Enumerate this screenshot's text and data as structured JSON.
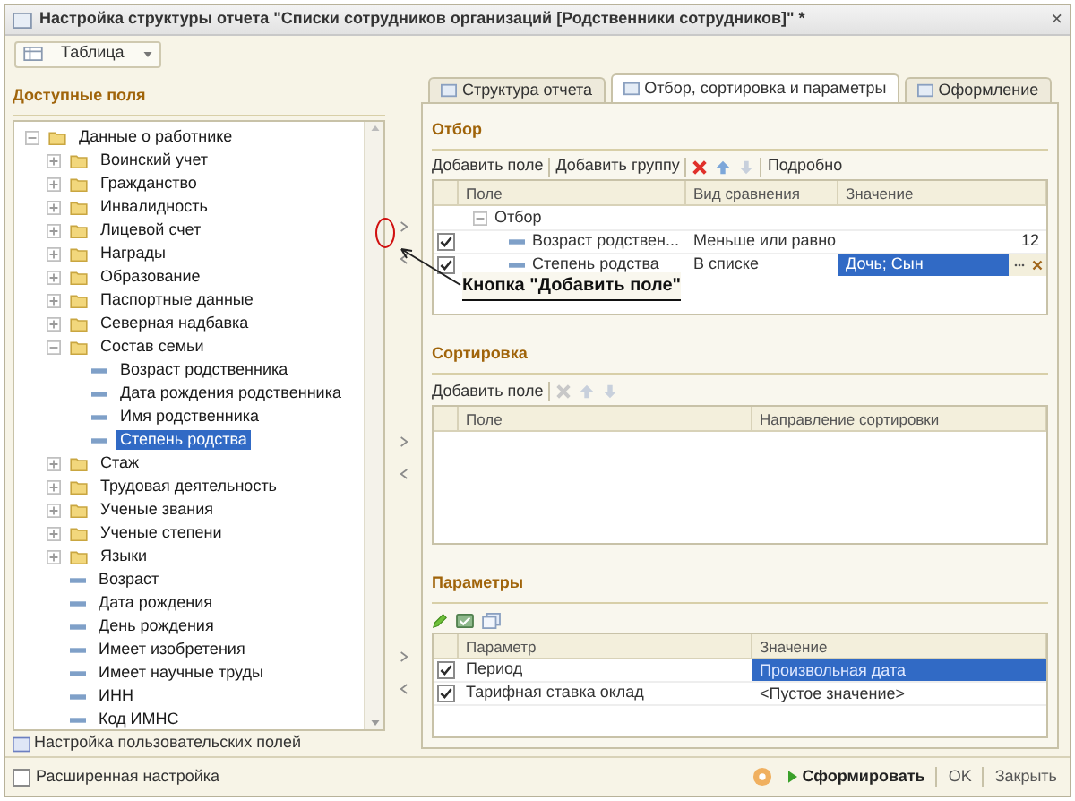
{
  "window": {
    "title": "Настройка структуры отчета \"Списки сотрудников организаций [Родственники сотрудников]\" *",
    "close": "×"
  },
  "view_selector": {
    "value": "Таблица"
  },
  "available_fields": {
    "title": "Доступные поля",
    "tree": [
      {
        "label": "Данные о работнике",
        "kind": "folder",
        "expanded": true,
        "selected": false,
        "children": [
          {
            "label": "Воинский учет",
            "kind": "folder",
            "expanded": false,
            "selected": false
          },
          {
            "label": "Гражданство",
            "kind": "folder",
            "expanded": false,
            "selected": false
          },
          {
            "label": "Инвалидность",
            "kind": "folder",
            "expanded": false,
            "selected": false
          },
          {
            "label": "Лицевой счет",
            "kind": "folder",
            "expanded": false,
            "selected": false
          },
          {
            "label": "Награды",
            "kind": "folder",
            "expanded": false,
            "selected": false
          },
          {
            "label": "Образование",
            "kind": "folder",
            "expanded": false,
            "selected": false
          },
          {
            "label": "Паспортные данные",
            "kind": "folder",
            "expanded": false,
            "selected": false
          },
          {
            "label": "Северная надбавка",
            "kind": "folder",
            "expanded": false,
            "selected": false
          },
          {
            "label": "Состав семьи",
            "kind": "folder",
            "expanded": true,
            "selected": false,
            "children": [
              {
                "label": "Возраст родственника",
                "kind": "field",
                "selected": false
              },
              {
                "label": "Дата рождения родственника",
                "kind": "field",
                "selected": false
              },
              {
                "label": "Имя родственника",
                "kind": "field",
                "selected": false
              },
              {
                "label": "Степень родства",
                "kind": "field",
                "selected": true
              }
            ]
          },
          {
            "label": "Стаж",
            "kind": "folder",
            "expanded": false,
            "selected": false
          },
          {
            "label": "Трудовая деятельность",
            "kind": "folder",
            "expanded": false,
            "selected": false
          },
          {
            "label": "Ученые звания",
            "kind": "folder",
            "expanded": false,
            "selected": false
          },
          {
            "label": "Ученые степени",
            "kind": "folder",
            "expanded": false,
            "selected": false
          },
          {
            "label": "Языки",
            "kind": "folder",
            "expanded": false,
            "selected": false
          },
          {
            "label": "Возраст",
            "kind": "field",
            "selected": false
          },
          {
            "label": "Дата рождения",
            "kind": "field",
            "selected": false
          },
          {
            "label": "День рождения",
            "kind": "field",
            "selected": false
          },
          {
            "label": "Имеет изобретения",
            "kind": "field",
            "selected": false
          },
          {
            "label": "Имеет научные труды",
            "kind": "field",
            "selected": false
          },
          {
            "label": "ИНН",
            "kind": "field",
            "selected": false
          },
          {
            "label": "Код ИМНС",
            "kind": "field",
            "selected": false
          }
        ]
      }
    ],
    "custom_fields_link": "Настройка пользовательских полей"
  },
  "tabs": [
    {
      "label": "Структура отчета",
      "selected": false
    },
    {
      "label": "Отбор, сортировка и параметры",
      "selected": true
    },
    {
      "label": "Оформление",
      "selected": false
    }
  ],
  "filter": {
    "title": "Отбор",
    "toolbar": [
      "Добавить поле",
      "Добавить группу",
      "Подробно"
    ],
    "columns": [
      "Поле",
      "Вид сравнения",
      "Значение"
    ],
    "group": {
      "label": "Отбор",
      "expanded": true
    },
    "rows": [
      {
        "checked": true,
        "field": "Возраст родствен...",
        "comparison": "Меньше или равно",
        "value": "12",
        "kind": "number",
        "selected": false
      },
      {
        "checked": true,
        "field": "Степень родства",
        "comparison": "В списке",
        "value": "Дочь; Сын",
        "kind": "list",
        "selected": true
      }
    ]
  },
  "sorting": {
    "title": "Сортировка",
    "toolbar": [
      "Добавить поле"
    ],
    "columns": [
      "Поле",
      "Направление сортировки"
    ]
  },
  "parameters": {
    "title": "Параметры",
    "columns": [
      "Параметр",
      "Значение"
    ],
    "rows": [
      {
        "checked": true,
        "name": "Период",
        "value": "Произвольная дата",
        "selected": true
      },
      {
        "checked": true,
        "name": "Тарифная ставка оклад",
        "value": "<Пустое значение>",
        "selected": false
      }
    ]
  },
  "annotation": {
    "text": "Кнопка \"Добавить поле\""
  },
  "footer": {
    "advanced": {
      "label": "Расширенная настройка",
      "checked": false
    },
    "buttons": [
      {
        "label": "Сформировать",
        "kind": "primary"
      },
      {
        "label": "OK",
        "kind": "plain"
      },
      {
        "label": "Закрыть",
        "kind": "plain"
      }
    ]
  }
}
